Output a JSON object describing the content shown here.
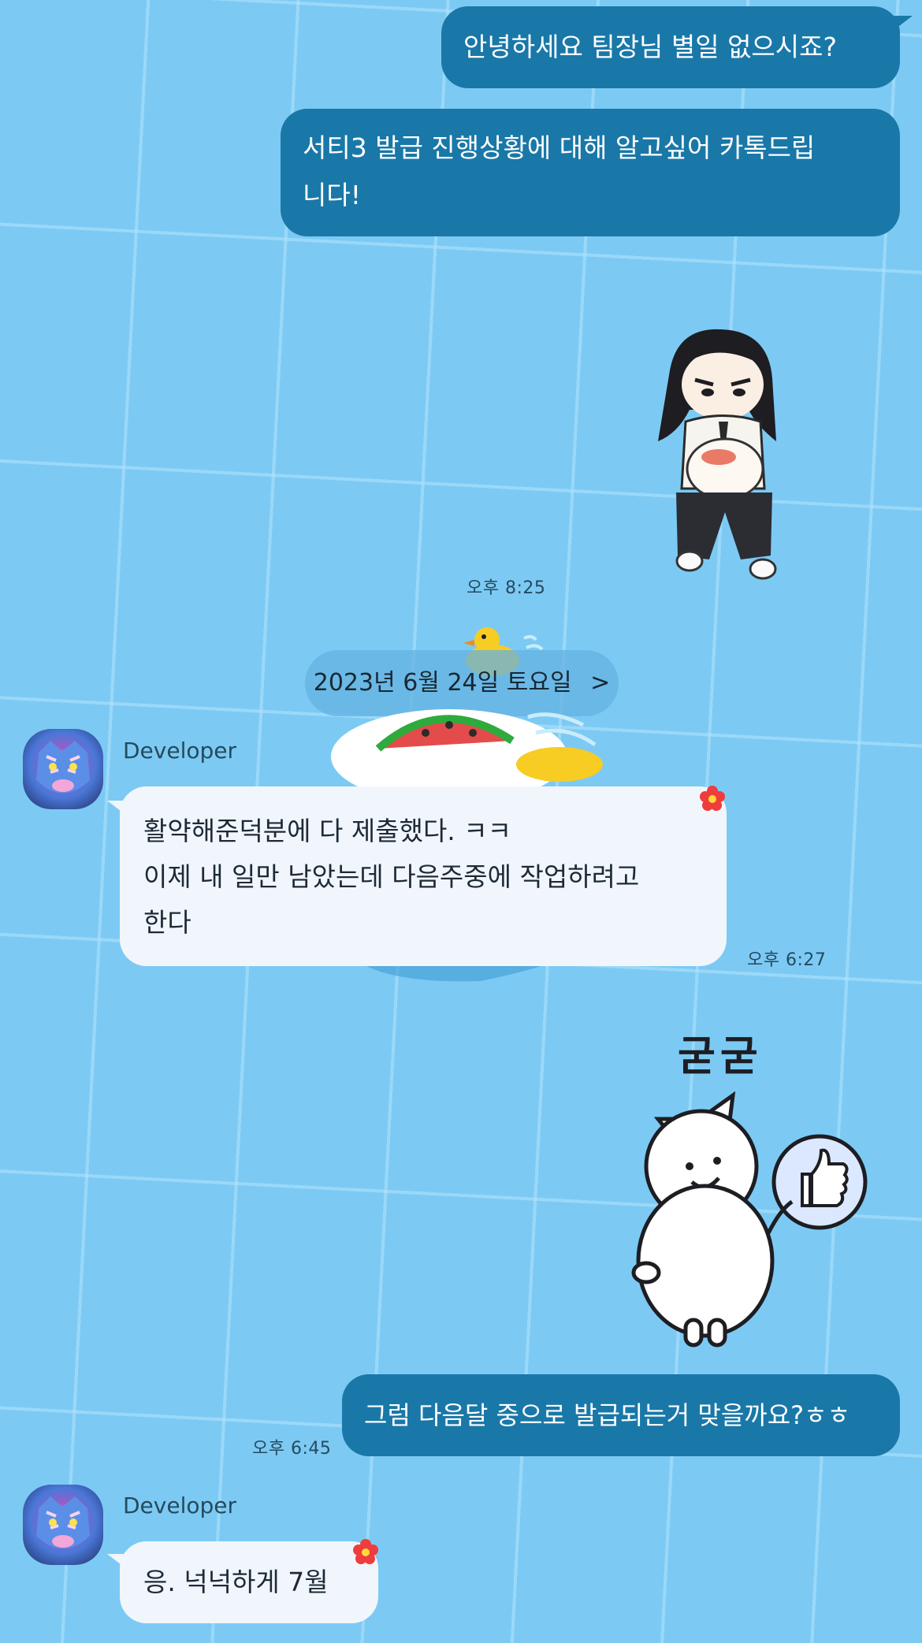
{
  "messages": {
    "out1": "안녕하세요 팀장님 별일 없으시죠?",
    "out2_line1": "서티3 발급 진행상황에 대해 알고싶어 카톡드립",
    "out2_line2": "니다!",
    "out3": "그럼 다음달 중으로 발급되는거 맞을까요?ㅎㅎ",
    "in1_line1": "활약해준덕분에 다 제출했다. ㅋㅋ",
    "in1_line2": "이제 내 일만 남았는데 다음주중에 작업하려고",
    "in1_line3": "한다",
    "in2": "응.  넉넉하게 7월"
  },
  "times": {
    "t1": "오후 8:25",
    "t2": "오후 6:27",
    "t3": "오후 6:45"
  },
  "date_divider": {
    "label": "2023년 6월 24일 토요일",
    "chevron": ">"
  },
  "sender": {
    "name": "Developer",
    "avatar_icon": "tiger-avatar-icon"
  },
  "stickers": {
    "pig_caption": "굳굳"
  },
  "colors": {
    "background": "#7ccaf4",
    "outgoing_bubble": "#1978a8",
    "incoming_bubble": "#f1f6fd"
  }
}
